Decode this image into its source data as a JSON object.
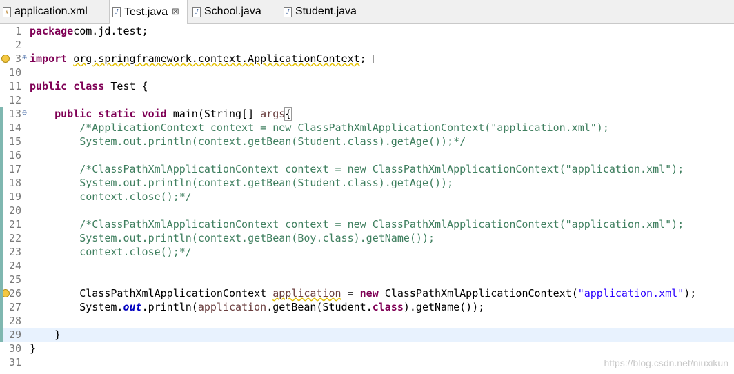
{
  "tabs": [
    {
      "label": "application.xml",
      "icon": "xml-file-icon",
      "active": false
    },
    {
      "label": "Test.java",
      "icon": "java-file-icon",
      "active": true,
      "close": "⊠"
    },
    {
      "label": "School.java",
      "icon": "java-file-icon",
      "active": false
    },
    {
      "label": "Student.java",
      "icon": "java-file-icon",
      "active": false
    }
  ],
  "lines": [
    {
      "num": "1",
      "tokens": [
        [
          "kw",
          "package"
        ],
        [
          "",
          "com.jd.test;"
        ]
      ]
    },
    {
      "num": "2",
      "tokens": []
    },
    {
      "num": "3",
      "fold": "⊕",
      "warning": true,
      "tokens": [
        [
          "kw",
          "import "
        ],
        [
          "warn",
          "org.springframework.context.ApplicationContext"
        ],
        [
          "",
          ";"
        ]
      ],
      "collapsed": true
    },
    {
      "num": "10",
      "tokens": []
    },
    {
      "num": "11",
      "tokens": [
        [
          "kw",
          "public"
        ],
        [
          "",
          ""
        ],
        [
          "kw",
          "class"
        ],
        [
          "",
          " Test {"
        ]
      ]
    },
    {
      "num": "12",
      "tokens": []
    },
    {
      "num": "13",
      "fold": "⊖",
      "tokens": [
        [
          "",
          "    "
        ],
        [
          "kw",
          "public"
        ],
        [
          "",
          " "
        ],
        [
          "kw",
          "static"
        ],
        [
          "",
          " "
        ],
        [
          "kw",
          "void"
        ],
        [
          "",
          " main(String[] "
        ],
        [
          "var",
          "args"
        ],
        [
          ") "
        ],
        [
          "bracket",
          "{"
        ]
      ]
    },
    {
      "num": "14",
      "tokens": [
        [
          "",
          "        "
        ],
        [
          "cm",
          "/*ApplicationContext context = new ClassPathXmlApplicationContext(\"application.xml\");"
        ]
      ]
    },
    {
      "num": "15",
      "tokens": [
        [
          "",
          "        "
        ],
        [
          "cm",
          "System.out.println(context.getBean(Student.class).getAge());*/"
        ]
      ]
    },
    {
      "num": "16",
      "tokens": []
    },
    {
      "num": "17",
      "tokens": [
        [
          "",
          "        "
        ],
        [
          "cm",
          "/*ClassPathXmlApplicationContext context = new ClassPathXmlApplicationContext(\"application.xml\");"
        ]
      ]
    },
    {
      "num": "18",
      "tokens": [
        [
          "",
          "        "
        ],
        [
          "cm",
          "System.out.println(context.getBean(Student.class).getAge());"
        ]
      ]
    },
    {
      "num": "19",
      "tokens": [
        [
          "",
          "        "
        ],
        [
          "cm",
          "context.close();*/"
        ]
      ]
    },
    {
      "num": "20",
      "tokens": []
    },
    {
      "num": "21",
      "tokens": [
        [
          "",
          "        "
        ],
        [
          "cm",
          "/*ClassPathXmlApplicationContext context = new ClassPathXmlApplicationContext(\"application.xml\");"
        ]
      ]
    },
    {
      "num": "22",
      "tokens": [
        [
          "",
          "        "
        ],
        [
          "cm",
          "System.out.println(context.getBean(Boy.class).getName());"
        ]
      ]
    },
    {
      "num": "23",
      "tokens": [
        [
          "",
          "        "
        ],
        [
          "cm",
          "context.close();*/"
        ]
      ]
    },
    {
      "num": "24",
      "tokens": []
    },
    {
      "num": "25",
      "tokens": []
    },
    {
      "num": "26",
      "warning": true,
      "tokens": [
        [
          "",
          "        ClassPathXmlApplicationContext "
        ],
        [
          "varwarn",
          "application"
        ],
        [
          "",
          " = "
        ],
        [
          "kw",
          "new"
        ],
        [
          "",
          " ClassPathXmlApplicationContext("
        ],
        [
          "str",
          "\"application.xml\""
        ],
        [
          "",
          ");"
        ]
      ]
    },
    {
      "num": "27",
      "tokens": [
        [
          "",
          "        System."
        ],
        [
          "fld",
          "out"
        ],
        [
          "",
          ".println("
        ],
        [
          "var",
          "application"
        ],
        [
          "",
          ".getBean(Student."
        ],
        [
          "kw",
          "class"
        ],
        [
          "",
          ").getName());"
        ]
      ]
    },
    {
      "num": "28",
      "tokens": []
    },
    {
      "num": "29",
      "current": true,
      "tokens": [
        [
          "",
          "    }"
        ],
        [
          "caret",
          ""
        ]
      ]
    },
    {
      "num": "30",
      "tokens": [
        [
          "",
          "}"
        ]
      ]
    },
    {
      "num": "31",
      "tokens": []
    }
  ],
  "watermark": "https://blog.csdn.net/niuxikun"
}
